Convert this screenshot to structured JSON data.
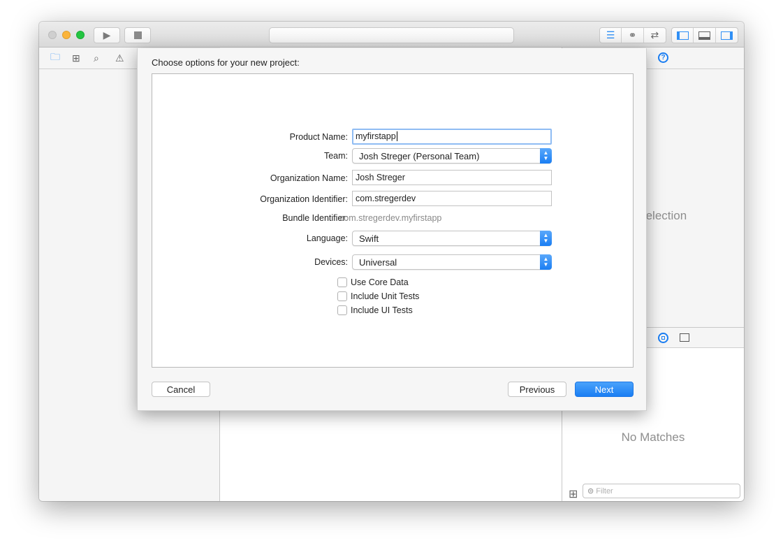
{
  "dialog": {
    "title": "Choose options for your new project:",
    "fields": {
      "product_name": {
        "label": "Product Name:",
        "value": "myfirstapp"
      },
      "team": {
        "label": "Team:",
        "value": "Josh Streger (Personal Team)"
      },
      "organization_name": {
        "label": "Organization Name:",
        "value": "Josh Streger"
      },
      "organization_identifier": {
        "label": "Organization Identifier:",
        "value": "com.stregerdev"
      },
      "bundle_identifier": {
        "label": "Bundle Identifier:",
        "value": "com.stregerdev.myfirstapp"
      },
      "language": {
        "label": "Language:",
        "value": "Swift"
      },
      "devices": {
        "label": "Devices:",
        "value": "Universal"
      }
    },
    "checkboxes": [
      {
        "label": "Use Core Data",
        "checked": false
      },
      {
        "label": "Include Unit Tests",
        "checked": false
      },
      {
        "label": "Include UI Tests",
        "checked": false
      }
    ],
    "buttons": {
      "cancel": "Cancel",
      "previous": "Previous",
      "next": "Next"
    }
  },
  "inspector": {
    "no_selection": "No Selection",
    "no_matches": "No Matches",
    "filter_placeholder": "Filter"
  },
  "colors": {
    "accent": "#1a7ef3",
    "close": "#cfcfcf",
    "minimize": "#fbb43a",
    "zoom": "#23c541"
  }
}
